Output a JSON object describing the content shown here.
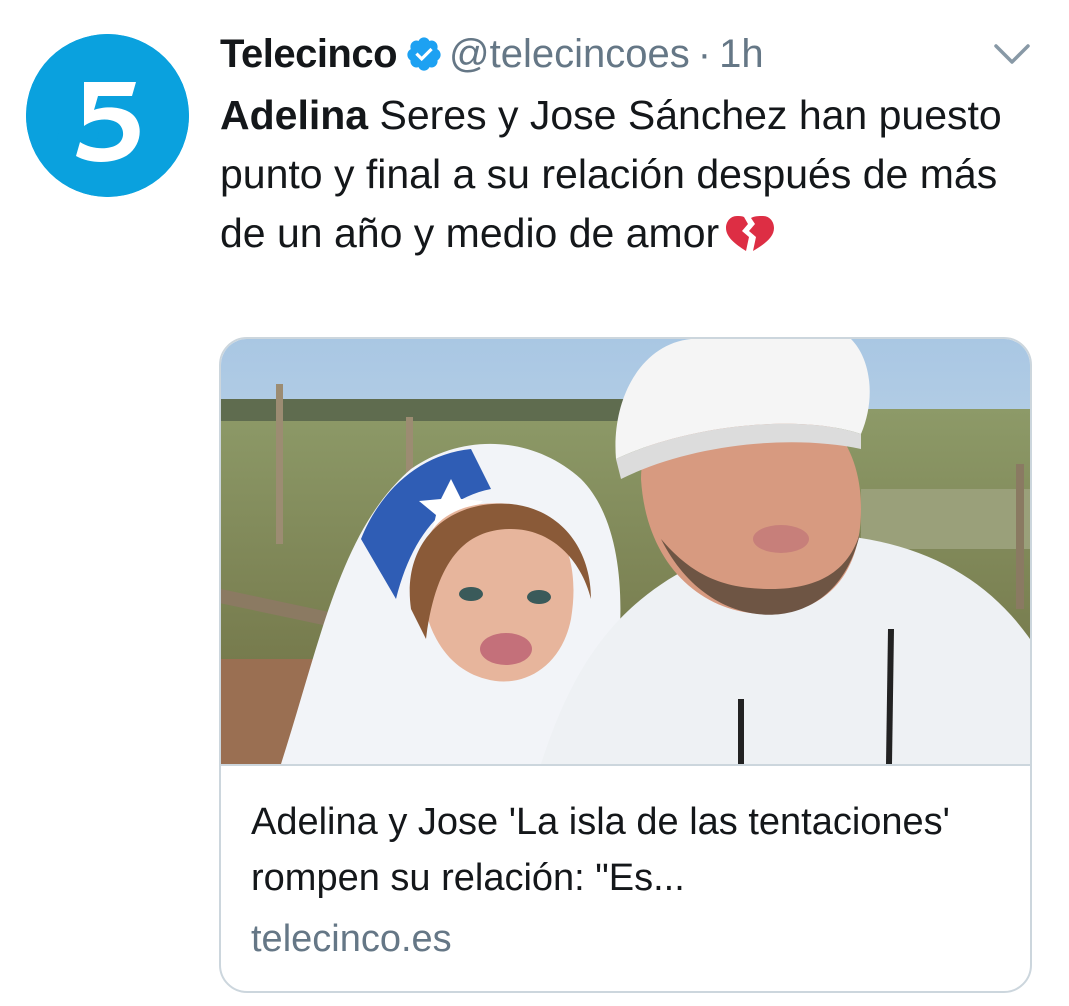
{
  "tweet": {
    "author_name": "Telecinco",
    "author_handle": "@telecincoes",
    "separator": "·",
    "time": "1h",
    "verified": true,
    "text_strong": "Adelina",
    "text_rest": " Seres y Jose Sánchez han puesto punto y final a su relación después de más de un año y medio de amor",
    "emoji": "broken-heart-icon"
  },
  "card": {
    "title": "Adelina y Jose 'La isla de las tentaciones' rompen su relación: \"Es...",
    "domain": "telecinco.es"
  },
  "colors": {
    "avatar_bg": "#0aa1de",
    "verified_blue": "#1da1f2",
    "secondary_text": "#657786",
    "border": "#ccd6dd"
  },
  "icons": {
    "avatar": "telecinco-logo-icon",
    "verified": "verified-badge-icon",
    "menu": "chevron-down-icon"
  }
}
